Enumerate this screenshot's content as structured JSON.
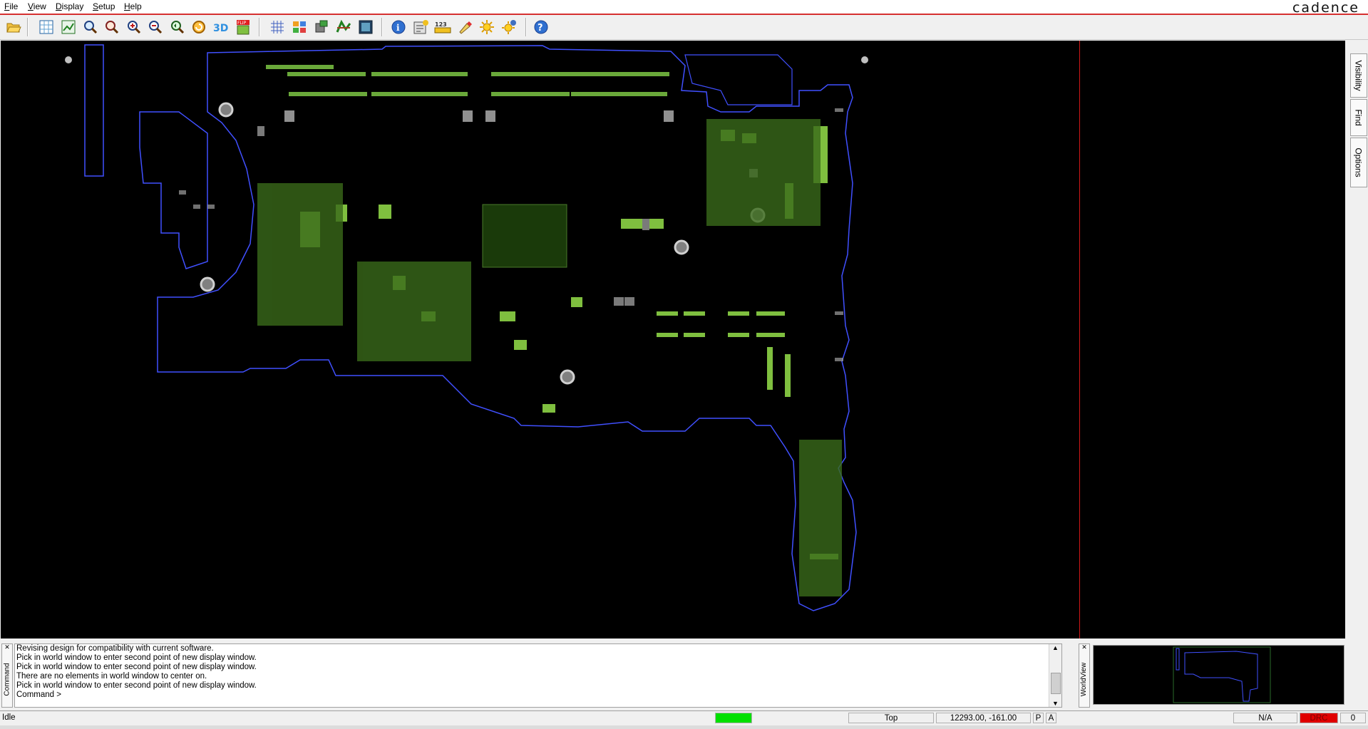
{
  "menu": {
    "items": [
      "File",
      "View",
      "Display",
      "Setup",
      "Help"
    ]
  },
  "brand": "cadence",
  "toolbar": {
    "icons": [
      "open-folder-icon",
      "zoom-fit-icon",
      "zoom-world-icon",
      "zoom-area-icon",
      "zoom-in-box-icon",
      "zoom-in-icon",
      "zoom-out-icon",
      "zoom-previous-icon",
      "refresh-icon",
      "view-3d-icon",
      "flip-icon",
      "grid-icon",
      "layers-icon",
      "components-icon",
      "nets-icon",
      "board-view-icon",
      "info-icon",
      "properties-icon",
      "measure-123-icon",
      "highlight-icon",
      "brightness-icon",
      "dehighlight-icon",
      "help-icon"
    ]
  },
  "side_tabs": [
    "Visibility",
    "Find",
    "Options"
  ],
  "command": {
    "panel_label": "Command",
    "lines": [
      "Revising design for compatibility with current software.",
      "Pick in world window to enter second point of new display window.",
      "Pick in world window to enter second point of new display window.",
      "There are no elements in world window to center on.",
      "Pick in world window to enter second point of new display window.",
      "Command >"
    ]
  },
  "worldview": {
    "panel_label": "WorldView"
  },
  "status": {
    "state": "Idle",
    "layer": "Top",
    "coords": "12293.00, -161.00",
    "p_label": "P",
    "a_label": "A",
    "na": "N/A",
    "drc": "DRC",
    "count": "0",
    "indicator_color": "#00e000",
    "drc_color": "#e00000"
  },
  "colors": {
    "board_outline": "#4050ff",
    "copper": "#7fbf3f",
    "background": "#000000",
    "divider": "#d01818"
  }
}
